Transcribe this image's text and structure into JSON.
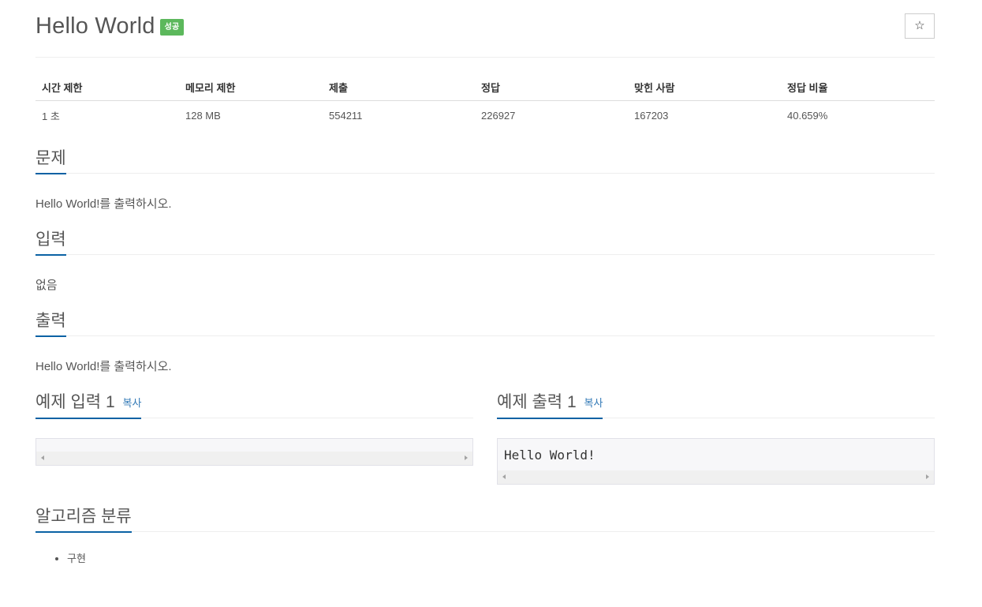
{
  "problem": {
    "title": "Hello World",
    "status_badge": "성공",
    "favorite_icon": "star-icon",
    "favorite_glyph": "☆"
  },
  "info_table": {
    "headers": [
      "시간 제한",
      "메모리 제한",
      "제출",
      "정답",
      "맞힌 사람",
      "정답 비율"
    ],
    "row": [
      "1 초",
      "128 MB",
      "554211",
      "226927",
      "167203",
      "40.659%"
    ]
  },
  "sections": {
    "description": {
      "heading": "문제",
      "text": "Hello World!를 출력하시오."
    },
    "input": {
      "heading": "입력",
      "text": "없음"
    },
    "output": {
      "heading": "출력",
      "text": "Hello World!를 출력하시오."
    }
  },
  "samples": {
    "input": {
      "heading": "예제 입력 1",
      "copy_label": "복사",
      "content": ""
    },
    "output": {
      "heading": "예제 출력 1",
      "copy_label": "복사",
      "content": "Hello World!"
    }
  },
  "tags": {
    "heading": "알고리즘 분류",
    "items": [
      "구현"
    ]
  },
  "colors": {
    "badge_success": "#5cb85c",
    "heading_underline": "#0b62a4",
    "link": "#337ab7"
  }
}
